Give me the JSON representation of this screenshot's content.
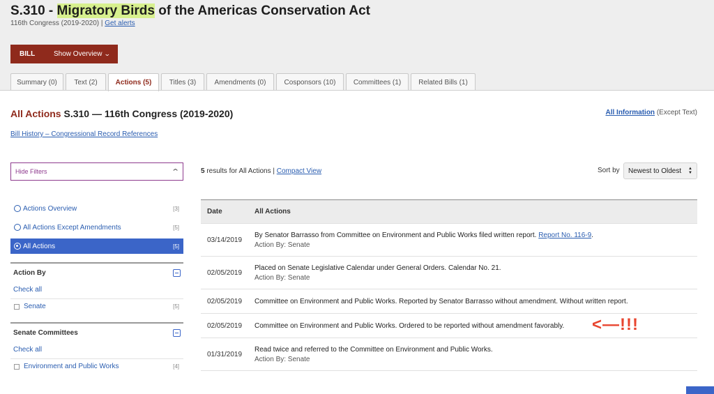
{
  "header": {
    "title_prefix": "S.310 - ",
    "title_highlight": "Migratory Birds",
    "title_suffix": " of the Americas Conservation Act",
    "congress": "116th Congress (2019-2020) | ",
    "get_alerts": "Get alerts",
    "bill_label": "BILL",
    "show_overview": "Show Overview",
    "accent_color": "#8f2a1c"
  },
  "tabs": [
    {
      "label": "Summary (0)",
      "active": false
    },
    {
      "label": "Text (2)",
      "active": false
    },
    {
      "label": "Actions (5)",
      "active": true
    },
    {
      "label": "Titles (3)",
      "active": false
    },
    {
      "label": "Amendments (0)",
      "active": false
    },
    {
      "label": "Cosponsors (10)",
      "active": false
    },
    {
      "label": "Committees (1)",
      "active": false
    },
    {
      "label": "Related Bills (1)",
      "active": false
    }
  ],
  "page": {
    "title_red": "All Actions",
    "title_rest": " S.310 — 116th Congress (2019-2020)",
    "all_info_link": "All Information",
    "all_info_suffix": " (Except Text)",
    "history_link": "Bill History – Congressional Record References"
  },
  "sidebar": {
    "hide_filters": "Hide Filters",
    "action_filters": [
      {
        "label": "Actions Overview",
        "count": "[3]",
        "selected": false
      },
      {
        "label": "All Actions Except Amendments",
        "count": "[5]",
        "selected": false
      },
      {
        "label": "All Actions",
        "count": "[5]",
        "selected": true
      }
    ],
    "action_by": {
      "heading": "Action By",
      "check_all": "Check all",
      "items": [
        {
          "label": "Senate",
          "count": "[5]"
        }
      ]
    },
    "senate_committees": {
      "heading": "Senate Committees",
      "check_all": "Check all",
      "items": [
        {
          "label": "Environment and Public Works",
          "count": "[4]"
        }
      ]
    }
  },
  "results": {
    "count": "5",
    "count_suffix": " results for All Actions | ",
    "compact_view": "Compact View",
    "sort_label": "Sort by",
    "sort_value": "Newest to Oldest"
  },
  "table": {
    "headers": [
      "Date",
      "All Actions"
    ],
    "rows": [
      {
        "date": "03/14/2019",
        "text": "By Senator Barrasso from Committee on Environment and Public Works filed written report. ",
        "link": "Report No. 116-9",
        "after": ".",
        "by": "Action By: Senate"
      },
      {
        "date": "02/05/2019",
        "text": "Placed on Senate Legislative Calendar under General Orders. Calendar No. 21.",
        "by": "Action By: Senate"
      },
      {
        "date": "02/05/2019",
        "text": "Committee on Environment and Public Works. Reported by Senator Barrasso without amendment. Without written report."
      },
      {
        "date": "02/05/2019",
        "text": "Committee on Environment and Public Works. Ordered to be reported without amendment favorably."
      },
      {
        "date": "01/31/2019",
        "text": "Read twice and referred to the Committee on Environment and Public Works.",
        "by": "Action By: Senate"
      }
    ]
  },
  "annotation": "<—!!!"
}
